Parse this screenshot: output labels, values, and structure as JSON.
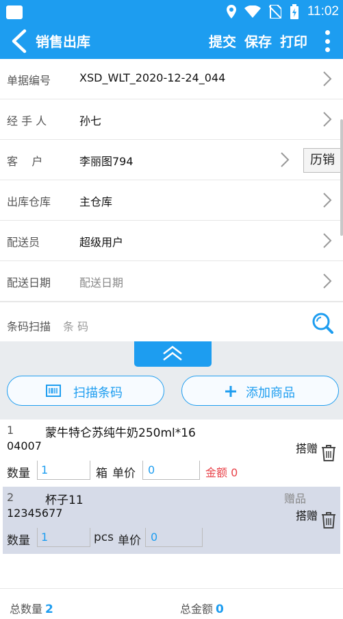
{
  "status_bar": {
    "time": "11:02"
  },
  "app_bar": {
    "title": "销售出库",
    "actions": [
      "提交",
      "保存",
      "打印"
    ]
  },
  "form": {
    "rows": [
      {
        "label": "单据编号",
        "value": "XSD_WLT_2020-12-24_044"
      },
      {
        "label": "经 手 人",
        "value": "孙七"
      },
      {
        "label": "客    户",
        "value": "李丽图794",
        "button": "历销"
      },
      {
        "label": "出库仓库",
        "value": "主仓库"
      },
      {
        "label": "配送员",
        "value": "超级用户"
      },
      {
        "label": "配送日期",
        "placeholder": "配送日期"
      }
    ],
    "barcode": {
      "label": "条码扫描",
      "placeholder": "条 码"
    }
  },
  "buttons": {
    "scan": "扫描条码",
    "add": "添加商品"
  },
  "items": [
    {
      "index": "1",
      "name": "蒙牛特仑苏纯牛奶250ml*16",
      "code": "04007",
      "gift_label": "搭赠",
      "qty_label": "数量",
      "qty": "1",
      "unit": "箱",
      "price_label": "单价",
      "price": "0",
      "amount_label": "金额",
      "amount": "0"
    },
    {
      "index": "2",
      "name": "杯子11",
      "code": "12345677",
      "tag": "赠品",
      "gift_label": "搭赠",
      "qty_label": "数量",
      "qty": "1",
      "unit": "pcs",
      "price_label": "单价",
      "price": "0"
    }
  ],
  "footer": {
    "total_qty_label": "总数量",
    "total_qty": "2",
    "total_amount_label": "总金额",
    "total_amount": "0"
  },
  "colors": {
    "primary": "#1d9df0",
    "amount": "#e8434a",
    "gift_row_bg": "#d6dbe8"
  },
  "icons": [
    "back-arrow-icon",
    "more-vert-icon",
    "chevron-right-icon",
    "search-scan-icon",
    "collapse-up-icon",
    "barcode-icon",
    "plus-icon",
    "trash-icon",
    "location-icon",
    "wifi-icon",
    "no-sim-icon",
    "battery-icon"
  ]
}
